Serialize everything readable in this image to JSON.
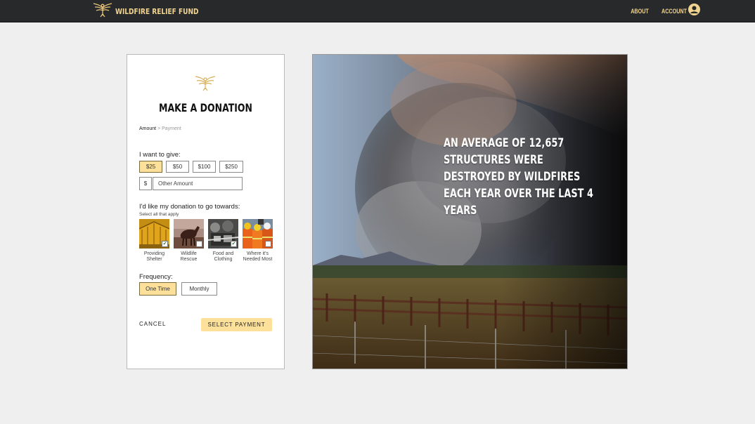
{
  "header": {
    "brand": "WILDFIRE RELIEF FUND",
    "nav_about": "ABOUT",
    "nav_account": "ACCOUNT"
  },
  "form": {
    "title": "MAKE A DONATION",
    "breadcrumb": {
      "current": "Amount",
      "separator": ">",
      "next": "Payment"
    },
    "give_label": "I want to give:",
    "amounts": [
      {
        "label": "$25",
        "selected": true
      },
      {
        "label": "$50",
        "selected": false
      },
      {
        "label": "$100",
        "selected": false
      },
      {
        "label": "$250",
        "selected": false
      }
    ],
    "currency_symbol": "$",
    "other_placeholder": "Other Amount",
    "towards_label": "I'd like my donation to go towards:",
    "select_hint": "Select all that apply",
    "causes": [
      {
        "label": "Providing Shelter",
        "checked": true
      },
      {
        "label": "Wildlife Rescue",
        "checked": false
      },
      {
        "label": "Food and Clothing",
        "checked": true
      },
      {
        "label": "Where it's Needed Most",
        "checked": false
      }
    ],
    "frequency_label": "Frequency:",
    "frequency": [
      {
        "label": "One Time",
        "selected": true
      },
      {
        "label": "Monthly",
        "selected": false
      }
    ],
    "cancel": "CANCEL",
    "submit": "SELECT PAYMENT"
  },
  "hero": {
    "text": "AN AVERAGE OF 12,657 STRUCTURES WERE DESTROYED BY WILDFIRES EACH YEAR OVER THE LAST 4 YEARS"
  },
  "colors": {
    "accent": "#fde09a",
    "brand_gold": "#f2d491",
    "topbar": "#27292b"
  }
}
